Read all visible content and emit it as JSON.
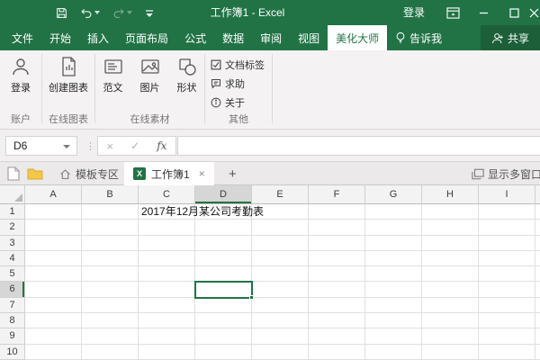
{
  "colors": {
    "excel_green": "#217346",
    "share_tab_green": "#1d5f38",
    "ribbon_bg": "#f4f2f2",
    "selected_header_bg": "#d6d6d6",
    "gridline": "#e0e0e0"
  },
  "title_bar": {
    "title": "工作簿1 - Excel",
    "sign_in": "登录",
    "qat_icons": [
      "save-icon",
      "undo-icon",
      "redo-icon",
      "customize-qat-icon"
    ],
    "window_icons": [
      "ribbon-display-options-icon",
      "minimize-icon",
      "maximize-icon",
      "close-icon"
    ]
  },
  "ribbon_tabs": [
    {
      "label": "文件",
      "active": false
    },
    {
      "label": "开始",
      "active": false
    },
    {
      "label": "插入",
      "active": false
    },
    {
      "label": "页面布局",
      "active": false
    },
    {
      "label": "公式",
      "active": false
    },
    {
      "label": "数据",
      "active": false
    },
    {
      "label": "审阅",
      "active": false
    },
    {
      "label": "视图",
      "active": false
    },
    {
      "label": "美化大师",
      "active": true
    },
    {
      "label": "告诉我",
      "active": false,
      "icon": "lightbulb-icon"
    },
    {
      "label": "共享",
      "active": false,
      "icon": "person-add-icon",
      "dark": true
    }
  ],
  "ribbon": {
    "group_account": {
      "name": "账户",
      "button_login": "登录"
    },
    "group_charts": {
      "name": "在线图表",
      "button_create_chart": "创建图表"
    },
    "group_assets": {
      "name": "在线素材",
      "button_sample": "范文",
      "button_picture": "图片",
      "button_shape": "形状"
    },
    "group_other": {
      "name": "其他",
      "item_doc_tags": "文档标签",
      "item_help": "求助",
      "item_about": "关于"
    }
  },
  "formula_bar": {
    "cell_ref": "D6",
    "cancel_glyph": "×",
    "enter_glyph": "✓",
    "fx_label": "fx",
    "formula_value": ""
  },
  "doc_bar": {
    "icons": [
      "new-file-icon",
      "folder-icon",
      "home-icon",
      "excel-logo-icon",
      "multi-window-icon"
    ],
    "template_tab": "模板专区",
    "doc_tab": "工作簿1",
    "doc_tab_close": "×",
    "new_tab": "+",
    "show_windows": "显示多窗口",
    "excel_logo_letter": "X"
  },
  "grid": {
    "columns": [
      "A",
      "B",
      "C",
      "D",
      "E",
      "F",
      "G",
      "H",
      "I"
    ],
    "rows": [
      "1",
      "2",
      "3",
      "4",
      "5",
      "6",
      "7",
      "8",
      "9",
      "10"
    ],
    "selected_cell": "D6",
    "selected_column_index": 3,
    "selected_row_index": 5,
    "c1_text": "2017年12月某公司考勤表"
  }
}
